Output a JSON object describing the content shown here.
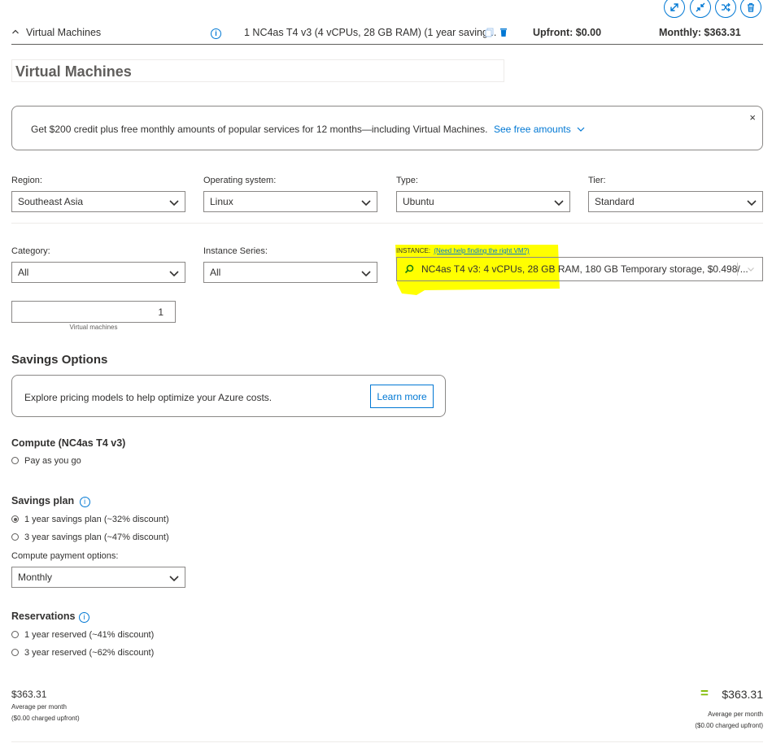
{
  "header": {
    "toggle_label": "Virtual Machines",
    "summary": "1 NC4as T4 v3 (4 vCPUs, 28 GB RAM) (1 year saving...",
    "upfront": "Upfront: $0.00",
    "monthly": "Monthly: $363.31"
  },
  "title_input": {
    "value": "Virtual Machines"
  },
  "banner": {
    "text": "Get $200 credit plus free monthly amounts of popular services for 12 months—including Virtual Machines.",
    "link": "See free amounts",
    "close": "×"
  },
  "filters": {
    "region": {
      "label": "Region:",
      "value": "Southeast Asia"
    },
    "os": {
      "label": "Operating system:",
      "value": "Linux"
    },
    "type": {
      "label": "Type:",
      "value": "Ubuntu"
    },
    "tier": {
      "label": "Tier:",
      "value": "Standard"
    },
    "category": {
      "label": "Category:",
      "value": "All"
    },
    "series": {
      "label": "Instance Series:",
      "value": "All"
    },
    "instance": {
      "label": "INSTANCE:",
      "help_link": "(Need help finding the right VM?)",
      "value": "NC4as T4 v3: 4 vCPUs, 28 GB RAM, 180 GB Temporary storage, $0.498/..."
    }
  },
  "vm_count": {
    "value": "1",
    "caption": "Virtual machines"
  },
  "savings": {
    "heading": "Savings Options",
    "explore_text": "Explore pricing models to help optimize your Azure costs.",
    "learn_more": "Learn more"
  },
  "compute": {
    "heading": "Compute (NC4as T4 v3)",
    "payg": "Pay as you go"
  },
  "savings_plan": {
    "heading": "Savings plan",
    "opt1": "1 year savings plan (~32% discount)",
    "opt2": "3 year savings plan (~47% discount)",
    "payment_label": "Compute payment options:",
    "payment_value": "Monthly"
  },
  "reservations": {
    "heading": "Reservations",
    "opt1": "1 year reserved (~41% discount)",
    "opt2": "3 year reserved (~62% discount)"
  },
  "totals": {
    "left_amount": "$363.31",
    "left_caption1": "Average per month",
    "left_caption2": "($0.00 charged upfront)",
    "equals": "=",
    "right_amount": "$363.31",
    "right_caption1": "Average per month",
    "right_caption2": "($0.00 charged upfront)"
  },
  "colors": {
    "accent": "#0078d4",
    "highlight": "#ffff00",
    "equals": "#7fba00"
  }
}
